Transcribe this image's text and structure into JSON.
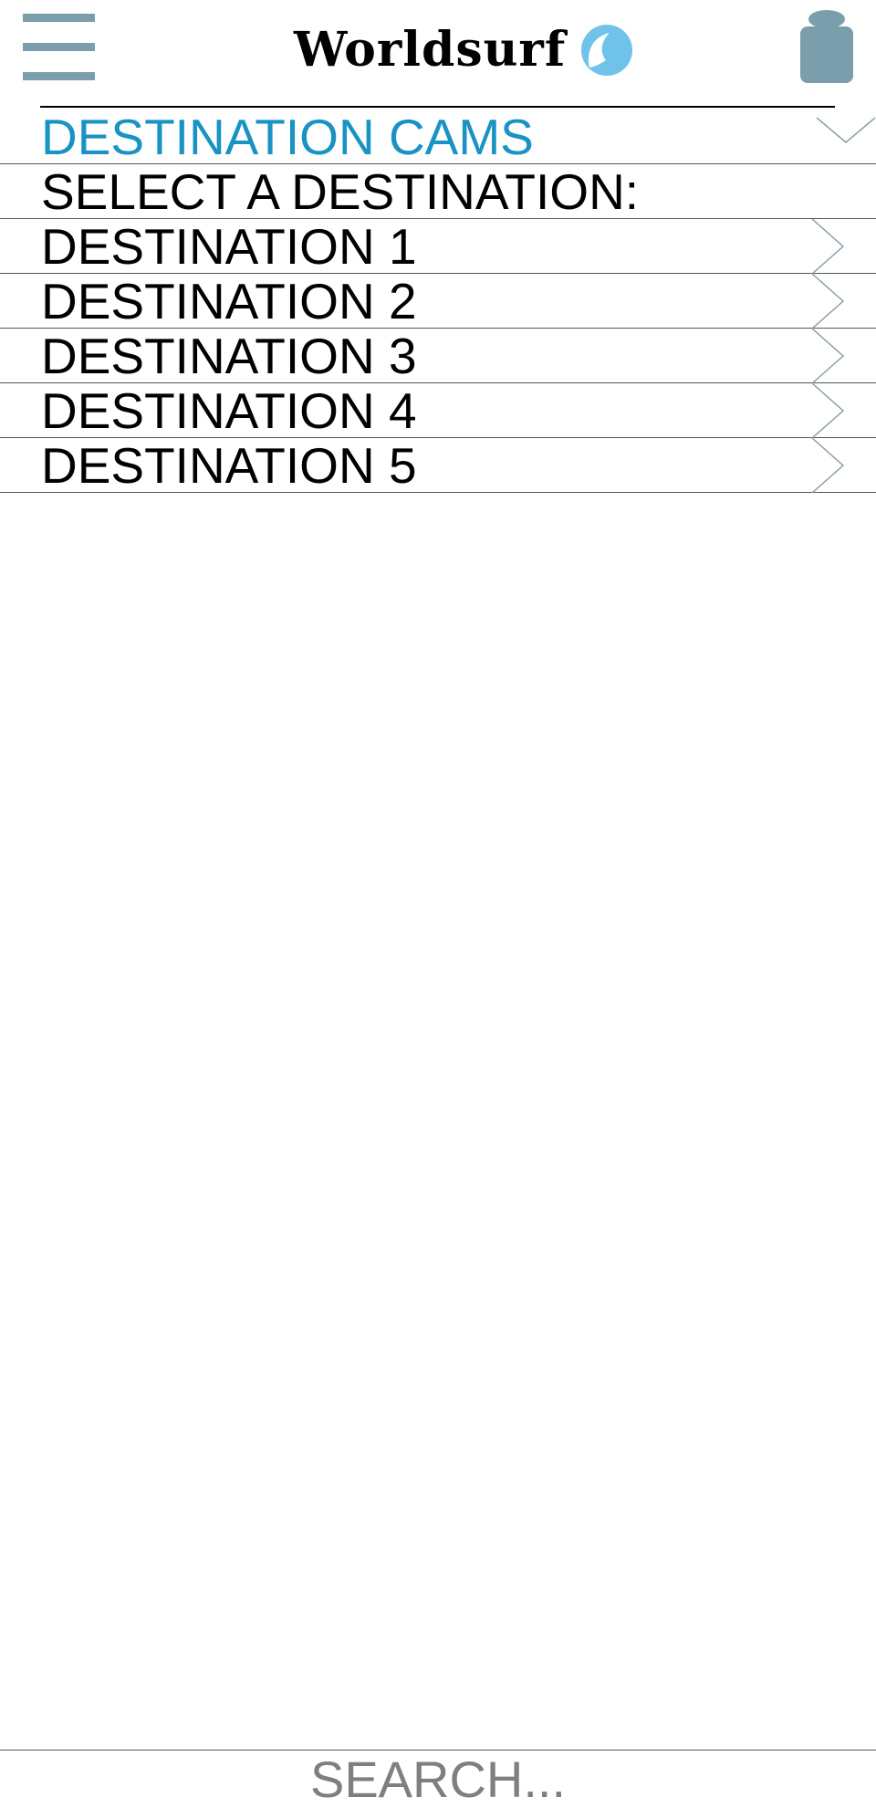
{
  "header": {
    "brand": "Worldsurf",
    "menu_icon": "hamburger-menu-icon",
    "user_icon": "user-icon",
    "brand_icon": "wave-icon"
  },
  "section": {
    "title": "DESTINATION CAMS"
  },
  "prompt": "SELECT A DESTINATION:",
  "destinations": [
    {
      "label": "DESTINATION 1"
    },
    {
      "label": "DESTINATION 2"
    },
    {
      "label": "DESTINATION 3"
    },
    {
      "label": "DESTINATION 4"
    },
    {
      "label": "DESTINATION 5"
    }
  ],
  "search": {
    "placeholder": "SEARCH..."
  },
  "colors": {
    "accent": "#1992c4",
    "icon": "#7a9eab",
    "wave": "#6fc3ea"
  }
}
